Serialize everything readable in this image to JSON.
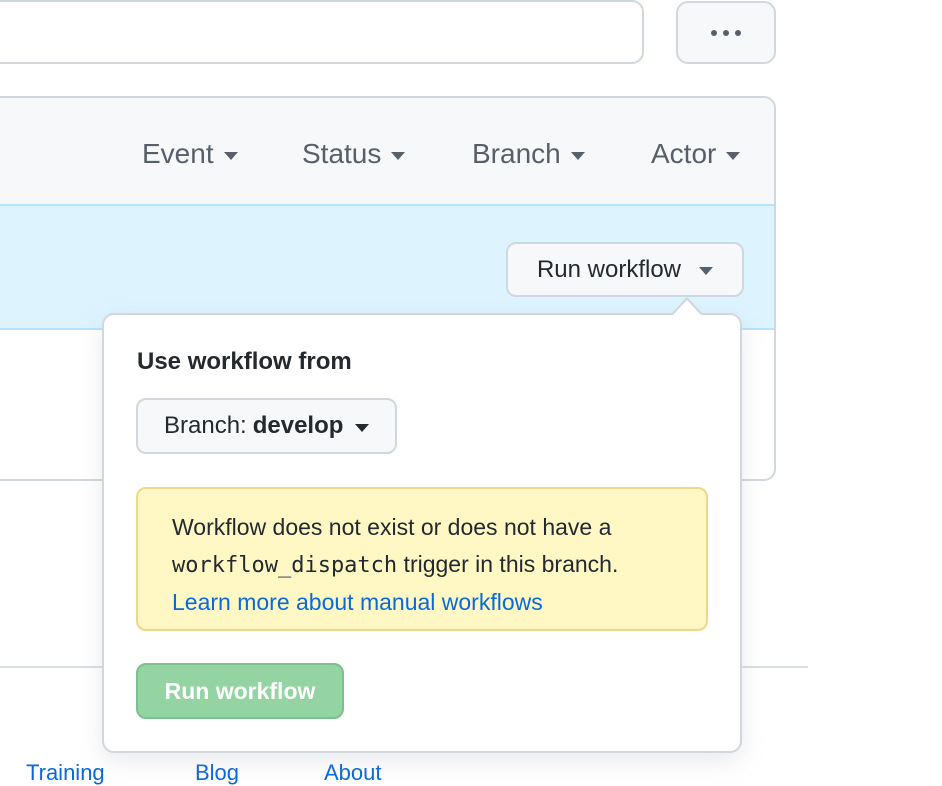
{
  "filters": {
    "event": "Event",
    "status": "Status",
    "branch": "Branch",
    "actor": "Actor"
  },
  "run_trigger_label": "Run workflow",
  "popover": {
    "title": "Use workflow from",
    "branch_prefix": "Branch:",
    "branch_value": "develop",
    "warning_line1": "Workflow does not exist or does not have a",
    "warning_code": "workflow_dispatch",
    "warning_line2_rest": " trigger in this branch.",
    "learn_link": "Learn more about manual workflows",
    "run_button": "Run workflow"
  },
  "footer": {
    "links": [
      "Training",
      "Blog",
      "About"
    ]
  },
  "colors": {
    "accent_blue": "#0969da",
    "highlight_band": "#ddf4ff",
    "warning_bg": "#fff8c5",
    "run_button_disabled": "#94d3a2"
  }
}
